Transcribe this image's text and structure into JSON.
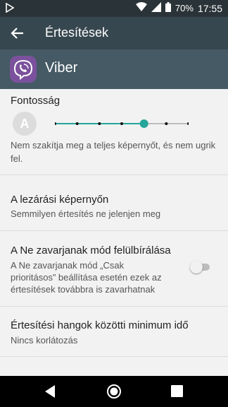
{
  "status_bar": {
    "battery": "70%",
    "time": "17:55"
  },
  "toolbar": {
    "title": "Értesítések"
  },
  "app": {
    "name": "Viber"
  },
  "importance": {
    "title": "Fontosság",
    "avatar_letter": "A",
    "level": 5,
    "levels": 7,
    "description": "Nem szakítja meg a teljes képernyőt, és nem ugrik fel."
  },
  "lockscreen": {
    "title": "A lezárási képernyőn",
    "subtitle": "Semmilyen értesítés ne jelenjen meg"
  },
  "dnd": {
    "title": "A Ne zavarjanak mód felülbírálása",
    "subtitle_lines": [
      "A Ne zavarjanak mód „Csak",
      "prioritásos” beállítása esetén ezek az",
      "értesítések továbbra is zavarhatnak"
    ],
    "toggle_on": false
  },
  "sound_interval": {
    "title": "Értesítési hangok közötti minimum idő",
    "subtitle": "Nincs korlátozás"
  },
  "colors": {
    "accent": "#26a69a",
    "toolbar": "#37474f",
    "header": "#455a64"
  }
}
